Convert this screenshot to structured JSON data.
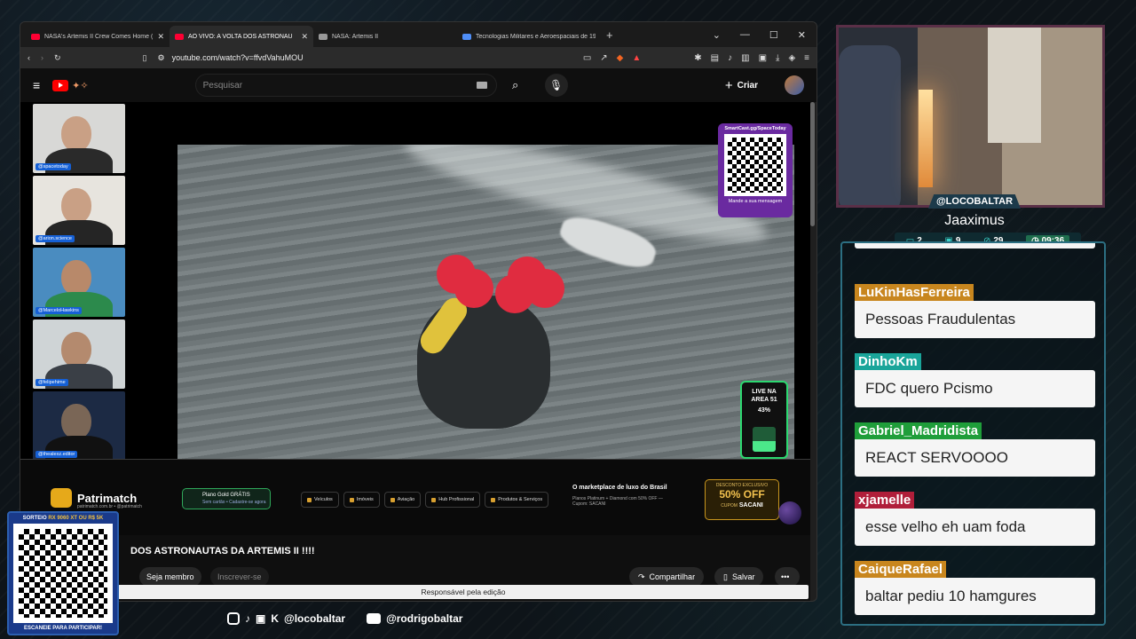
{
  "browser": {
    "tabs": [
      {
        "title": "NASA's Artemis II Crew Comes Home (",
        "favicon_color": "#ff0033",
        "active": false
      },
      {
        "title": "AO VIVO: A VOLTA DOS ASTRONAU",
        "favicon_color": "#ff0033",
        "active": true
      },
      {
        "title": "NASA: Artemis II",
        "favicon_color": "#999999",
        "active": false
      },
      {
        "title": "Tecnologias Militares e Aeroespaciais de 196",
        "favicon_color": "#4f8ef7",
        "active": false
      }
    ],
    "url": "youtube.com/watch?v=ffvdVahuMOU"
  },
  "youtube": {
    "search_placeholder": "Pesquisar",
    "create_label": "Criar"
  },
  "stream": {
    "participants": [
      "@spacetoday",
      "@arion.science",
      "@MarceloHawkins",
      "@felipehime",
      "@thealexz.editor"
    ],
    "qr_top": "SmartCast.gg/SpaceToday",
    "qr_bottom": "Mande a sua mensagem",
    "gauge_label_1": "LIVE NA",
    "gauge_label_2": "AREA 51",
    "gauge_percent": "43%",
    "gauge_fill": 0.43,
    "ad": {
      "brand": "Patrimatch",
      "brand_sub": "patrimatch.com.br • @patrimatch",
      "plan_title": "Plano Gold GRÁTIS",
      "plan_sub": "Sem cartão • Cadastre-se agora",
      "categories": [
        "Veículos",
        "Imóveis",
        "Aviação",
        "Hub Profissional",
        "Produtos & Serviços"
      ],
      "headline": "O marketplace de luxo do Brasil",
      "headline_sub": "Planos Platinum + Diamond com 50% OFF — Cupom: SACANI",
      "discount_top": "DESCONTO EXCLUSIVO",
      "discount": "50% OFF",
      "coupon_label": "CUPOM",
      "coupon": "SACANI"
    }
  },
  "video": {
    "title": "DOS ASTRONAUTAS DA ARTEMIS II !!!!",
    "member_label": "Seja membro",
    "subscribe_label": "Inscrever-se",
    "share_label": "Compartilhar",
    "save_label": "Salvar",
    "more_label": "•••",
    "tooltip": "Responsável pela edição"
  },
  "streamer": {
    "handle": "@LOCOBALTAR",
    "nick": "Jaaximus",
    "stats": [
      {
        "icon": "▭",
        "value": "2"
      },
      {
        "icon": "▣",
        "value": "9"
      },
      {
        "icon": "⊘",
        "value": "29"
      }
    ],
    "time": "09:36"
  },
  "chat": [
    {
      "user": "LuKinHasFerreira",
      "color": "#c8861e",
      "text": "Pessoas Fraudulentas"
    },
    {
      "user": "DinhoKm",
      "color": "#1aa59a",
      "text": "FDC quero Pcismo"
    },
    {
      "user": "Gabriel_Madridista",
      "color": "#1f9e3a",
      "text": "REACT SERVOOOO"
    },
    {
      "user": "xjamelle",
      "color": "#b01e3a",
      "text": "esse velho eh uam foda"
    },
    {
      "user": "CaiqueRafael",
      "color": "#c8861e",
      "text": "baltar pediu 10 hamgures"
    }
  ],
  "socials": {
    "handle1": "@locobaltar",
    "handle2": "@rodrigobaltar"
  },
  "sorteio": {
    "top": "SORTEIO",
    "prize": "RX 9060 XT OU R$ 5K",
    "bottom": "ESCANEIE PARA PARTICIPAR!"
  },
  "colors": {
    "accent_teal": "#2c6f82",
    "brand_red": "#ff0000",
    "gold": "#f2c14e"
  }
}
